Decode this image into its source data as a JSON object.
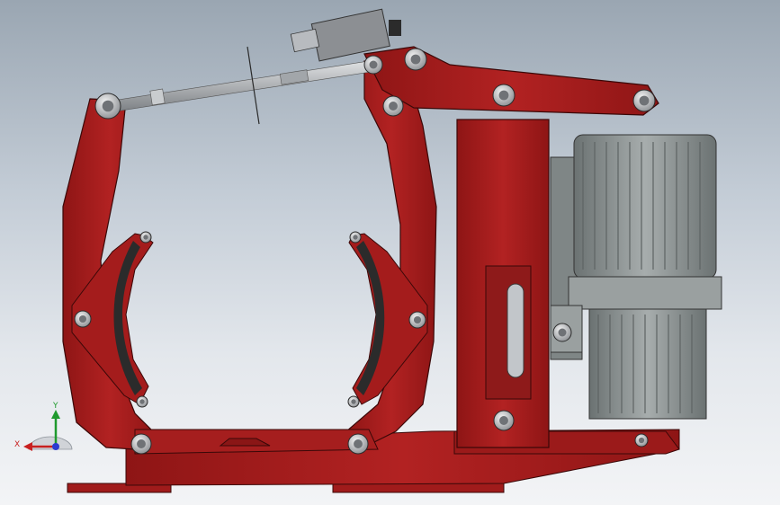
{
  "viewport": {
    "background_top": "#9aa6b2",
    "background_bottom": "#f3f4f6"
  },
  "model": {
    "frame_color": "#a81c1c",
    "frame_shadow": "#7d1212",
    "frame_outline": "#3a0808",
    "lining_color": "#2d2d2d",
    "motor_color": "#8f9696",
    "motor_dark": "#5e6464",
    "metal_color": "#b9bdc2",
    "bolt_color": "#d8d9db"
  },
  "triad": {
    "x_label": "X",
    "y_label": "Y",
    "x_color": "#c82020",
    "y_color": "#1f9a2e",
    "z_color": "#2b3bd0"
  }
}
